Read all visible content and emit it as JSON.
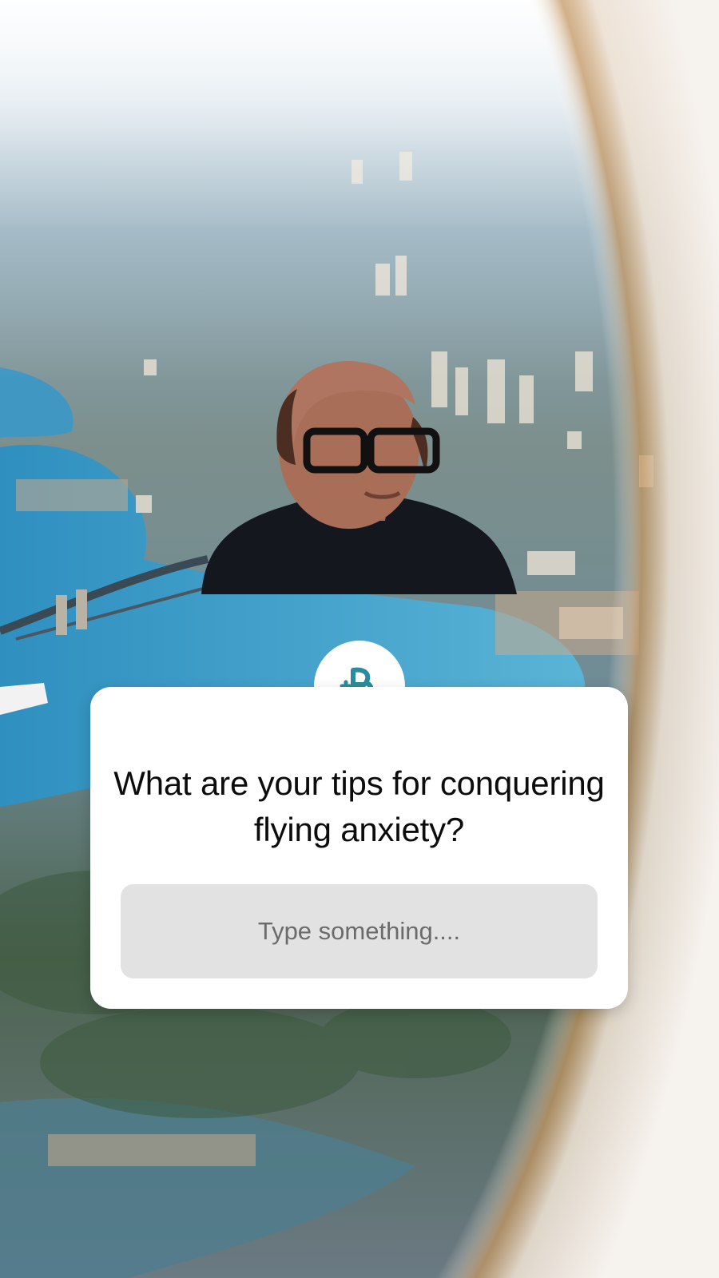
{
  "card": {
    "question": "What are your tips for conquering flying anxiety?",
    "input_placeholder": "Type something....",
    "input_value": ""
  },
  "colors": {
    "card_bg": "#ffffff",
    "input_bg": "#e2e2e2",
    "logo_accent": "#2a8c9e",
    "water": "#3d9fc7"
  },
  "icons": {
    "logo": "b-brand-logo-icon"
  }
}
